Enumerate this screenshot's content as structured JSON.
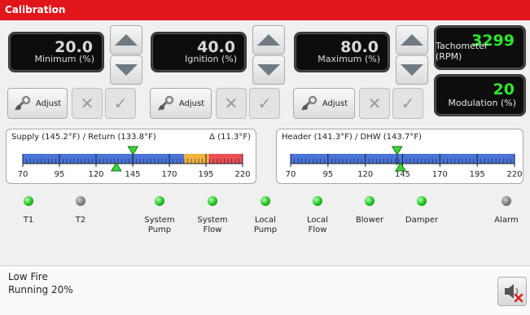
{
  "title": "Calibration",
  "displays": {
    "minimum": {
      "value": "20.0",
      "label": "Minimum (%)"
    },
    "ignition": {
      "value": "40.0",
      "label": "Ignition (%)"
    },
    "maximum": {
      "value": "80.0",
      "label": "Maximum (%)"
    },
    "tachometer": {
      "value": "3299",
      "label": "Tachometer (RPM)"
    },
    "modulation": {
      "value": "20",
      "label": "Modulation (%)"
    }
  },
  "buttons": {
    "adjust_label": "Adjust"
  },
  "gauge_left": {
    "title": "Supply (145.2°F) / Return (133.8°F)",
    "delta": "Δ (11.3°F)",
    "ticks": [
      "70",
      "95",
      "120",
      "145",
      "170",
      "195",
      "220"
    ],
    "supply": 145.2,
    "return": 133.8
  },
  "gauge_right": {
    "title": "Header (141.3°F) / DHW (143.7°F)",
    "ticks": [
      "70",
      "95",
      "120",
      "145",
      "170",
      "195",
      "220"
    ],
    "header": 141.3,
    "dhw": 143.7
  },
  "leds": [
    {
      "l1": "T1",
      "l2": "",
      "on": true
    },
    {
      "l1": "T2",
      "l2": "",
      "on": false
    },
    {
      "l1": "System",
      "l2": "Pump",
      "on": true
    },
    {
      "l1": "System",
      "l2": "Flow",
      "on": true
    },
    {
      "l1": "Local",
      "l2": "Pump",
      "on": true
    },
    {
      "l1": "Local",
      "l2": "Flow",
      "on": true
    },
    {
      "l1": "Blower",
      "l2": "",
      "on": true
    },
    {
      "l1": "Damper",
      "l2": "",
      "on": true
    },
    {
      "l1": "Alarm",
      "l2": "",
      "on": false
    }
  ],
  "status": {
    "line1": "Low Fire",
    "line2": "Running 20%"
  },
  "colors": {
    "title_bar": "#e0161b",
    "lcd_green": "#2ee62e",
    "scale_blue": "#4a74d6",
    "scale_amber": "#f0b43c",
    "scale_red": "#ec5050"
  }
}
